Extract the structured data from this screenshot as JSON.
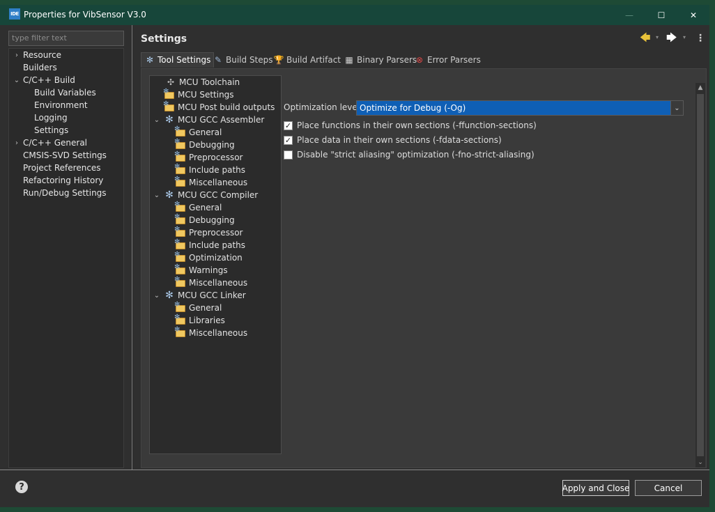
{
  "window": {
    "app_icon": "IDE",
    "title": "Properties for VibSensor V3.0",
    "minimize": "—",
    "maximize": "☐",
    "close": "✕"
  },
  "filter": {
    "placeholder": "type filter text"
  },
  "nav": {
    "items": [
      {
        "label": "Resource",
        "chevron": "›"
      },
      {
        "label": "Builders"
      },
      {
        "label": "C/C++ Build",
        "chevron": "⌄"
      },
      {
        "label": "Build Variables"
      },
      {
        "label": "Environment"
      },
      {
        "label": "Logging"
      },
      {
        "label": "Settings"
      },
      {
        "label": "C/C++ General",
        "chevron": "›"
      },
      {
        "label": "CMSIS-SVD Settings"
      },
      {
        "label": "Project References"
      },
      {
        "label": "Refactoring History"
      },
      {
        "label": "Run/Debug Settings"
      }
    ]
  },
  "header": {
    "title": "Settings",
    "back": "🡄",
    "forward": "🡆",
    "dropdown": "▾",
    "menu": "⋮"
  },
  "tabs": [
    {
      "label": "Tool Settings",
      "icon": "✻"
    },
    {
      "label": "Build Steps",
      "icon": "✎"
    },
    {
      "label": "Build Artifact",
      "icon": "🏆"
    },
    {
      "label": "Binary Parsers",
      "icon": "▦"
    },
    {
      "label": "Error Parsers",
      "icon": "⊗"
    }
  ],
  "tree": {
    "nodes": [
      {
        "label": "MCU Toolchain"
      },
      {
        "label": "MCU Settings"
      },
      {
        "label": "MCU Post build outputs"
      },
      {
        "label": "MCU GCC Assembler",
        "chevron": "⌄"
      },
      {
        "label": "General"
      },
      {
        "label": "Debugging"
      },
      {
        "label": "Preprocessor"
      },
      {
        "label": "Include paths"
      },
      {
        "label": "Miscellaneous"
      },
      {
        "label": "MCU GCC Compiler",
        "chevron": "⌄"
      },
      {
        "label": "General"
      },
      {
        "label": "Debugging"
      },
      {
        "label": "Preprocessor"
      },
      {
        "label": "Include paths"
      },
      {
        "label": "Optimization"
      },
      {
        "label": "Warnings"
      },
      {
        "label": "Miscellaneous"
      },
      {
        "label": "MCU GCC Linker",
        "chevron": "⌄"
      },
      {
        "label": "General"
      },
      {
        "label": "Libraries"
      },
      {
        "label": "Miscellaneous"
      }
    ],
    "icons": {
      "gear": "✻",
      "chip": "✣"
    }
  },
  "optimization": {
    "label": "Optimization level",
    "value": "Optimize for Debug (-Og)",
    "arrow": "⌄"
  },
  "checkboxes": [
    {
      "label": "Place functions in their own sections (-ffunction-sections)",
      "checked": true
    },
    {
      "label": "Place data in their own sections (-fdata-sections)",
      "checked": true
    },
    {
      "label": "Disable \"strict aliasing\" optimization (-fno-strict-aliasing)",
      "checked": false
    }
  ],
  "checkmark": "✓",
  "scroll": {
    "up": "▲",
    "down": "⌄"
  },
  "footer": {
    "help": "?",
    "apply_label": "Apply and Close",
    "cancel_label": "Cancel"
  }
}
